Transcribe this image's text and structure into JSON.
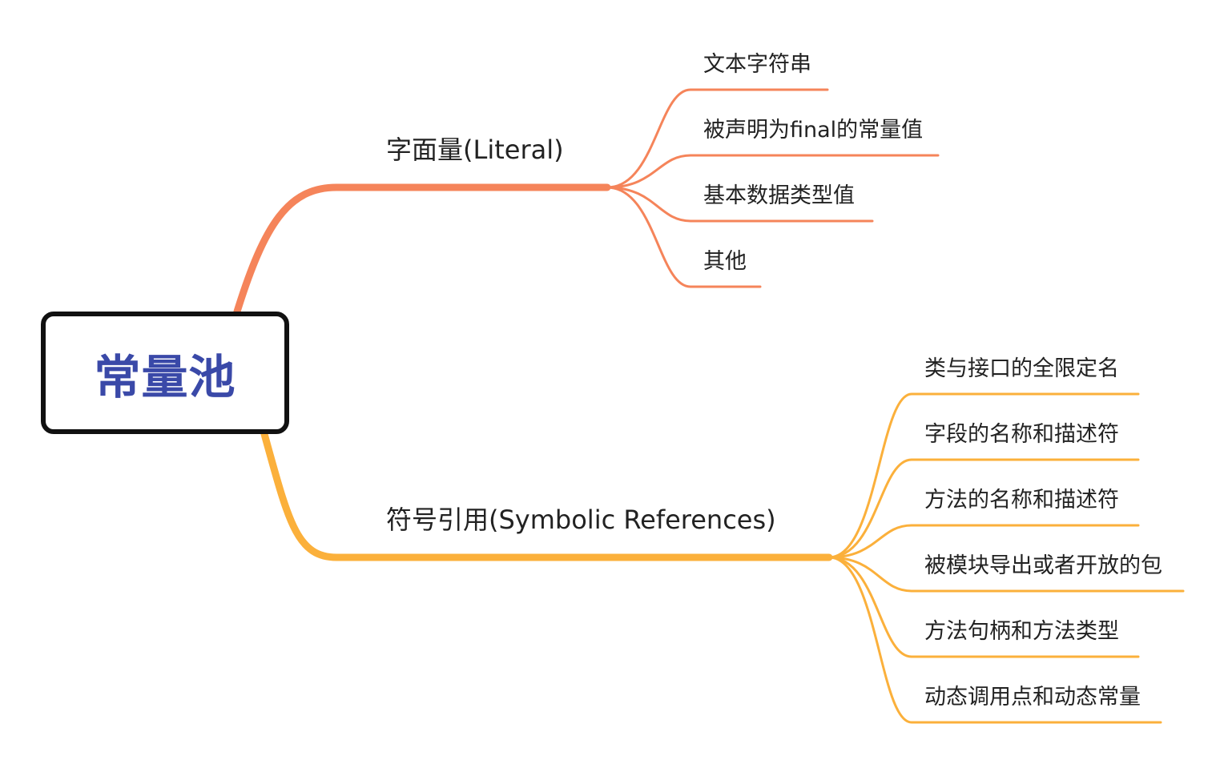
{
  "root": {
    "label": "常量池"
  },
  "branches": [
    {
      "label": "字面量(Literal)",
      "color": "#f5845a",
      "children": [
        "文本字符串",
        "被声明为final的常量值",
        "基本数据类型值",
        "其他"
      ]
    },
    {
      "label": "符号引用(Symbolic References)",
      "color": "#fbb03b",
      "children": [
        "类与接口的全限定名",
        "字段的名称和描述符",
        "方法的名称和描述符",
        "被模块导出或者开放的包",
        "方法句柄和方法类型",
        "动态调用点和动态常量"
      ]
    }
  ],
  "colors": {
    "root_text": "#3a49a8",
    "root_border": "#111111",
    "text": "#222222"
  }
}
